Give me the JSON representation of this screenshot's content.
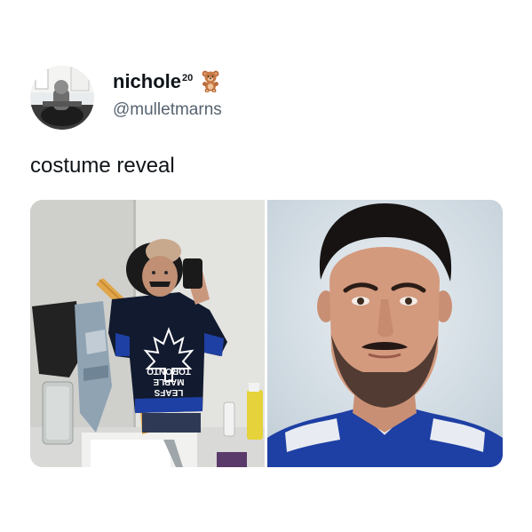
{
  "author": {
    "display_name": "nichole",
    "display_name_superscript": "20",
    "emoji_icon": "teddy-bear-icon",
    "handle": "@mulletmarns"
  },
  "tweet": {
    "text": "costume reveal"
  },
  "media": {
    "left_photo": {
      "jersey_text_line1": "TORONTO",
      "jersey_text_line2": "MAPLE",
      "jersey_text_line3": "LEAFS"
    },
    "right_photo": {}
  },
  "colors": {
    "background": "#ffffff",
    "name": "#0f1419",
    "handle": "#566370",
    "leafs_blue": "#1e3fa4"
  }
}
